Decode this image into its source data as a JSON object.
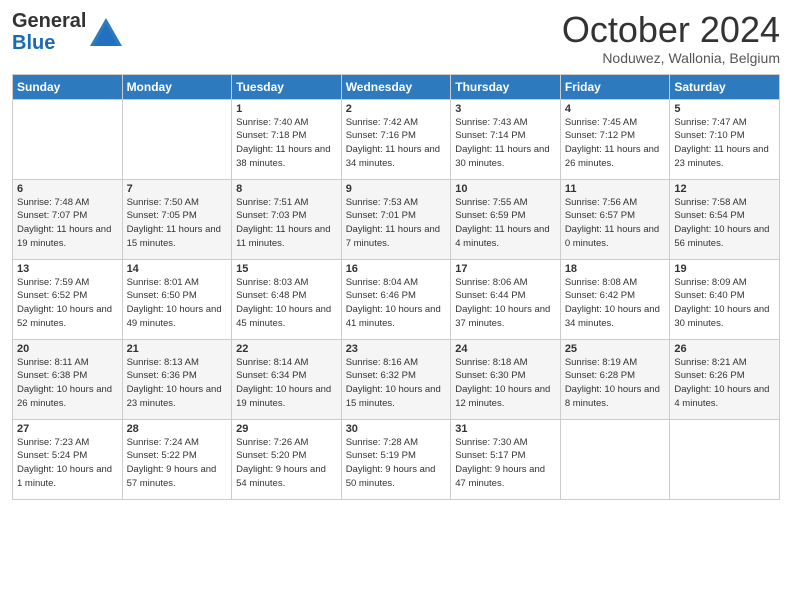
{
  "header": {
    "logo_line1": "General",
    "logo_line2": "Blue",
    "month": "October 2024",
    "location": "Noduwez, Wallonia, Belgium"
  },
  "days_of_week": [
    "Sunday",
    "Monday",
    "Tuesday",
    "Wednesday",
    "Thursday",
    "Friday",
    "Saturday"
  ],
  "weeks": [
    [
      {
        "day": "",
        "info": ""
      },
      {
        "day": "",
        "info": ""
      },
      {
        "day": "1",
        "info": "Sunrise: 7:40 AM\nSunset: 7:18 PM\nDaylight: 11 hours and 38 minutes."
      },
      {
        "day": "2",
        "info": "Sunrise: 7:42 AM\nSunset: 7:16 PM\nDaylight: 11 hours and 34 minutes."
      },
      {
        "day": "3",
        "info": "Sunrise: 7:43 AM\nSunset: 7:14 PM\nDaylight: 11 hours and 30 minutes."
      },
      {
        "day": "4",
        "info": "Sunrise: 7:45 AM\nSunset: 7:12 PM\nDaylight: 11 hours and 26 minutes."
      },
      {
        "day": "5",
        "info": "Sunrise: 7:47 AM\nSunset: 7:10 PM\nDaylight: 11 hours and 23 minutes."
      }
    ],
    [
      {
        "day": "6",
        "info": "Sunrise: 7:48 AM\nSunset: 7:07 PM\nDaylight: 11 hours and 19 minutes."
      },
      {
        "day": "7",
        "info": "Sunrise: 7:50 AM\nSunset: 7:05 PM\nDaylight: 11 hours and 15 minutes."
      },
      {
        "day": "8",
        "info": "Sunrise: 7:51 AM\nSunset: 7:03 PM\nDaylight: 11 hours and 11 minutes."
      },
      {
        "day": "9",
        "info": "Sunrise: 7:53 AM\nSunset: 7:01 PM\nDaylight: 11 hours and 7 minutes."
      },
      {
        "day": "10",
        "info": "Sunrise: 7:55 AM\nSunset: 6:59 PM\nDaylight: 11 hours and 4 minutes."
      },
      {
        "day": "11",
        "info": "Sunrise: 7:56 AM\nSunset: 6:57 PM\nDaylight: 11 hours and 0 minutes."
      },
      {
        "day": "12",
        "info": "Sunrise: 7:58 AM\nSunset: 6:54 PM\nDaylight: 10 hours and 56 minutes."
      }
    ],
    [
      {
        "day": "13",
        "info": "Sunrise: 7:59 AM\nSunset: 6:52 PM\nDaylight: 10 hours and 52 minutes."
      },
      {
        "day": "14",
        "info": "Sunrise: 8:01 AM\nSunset: 6:50 PM\nDaylight: 10 hours and 49 minutes."
      },
      {
        "day": "15",
        "info": "Sunrise: 8:03 AM\nSunset: 6:48 PM\nDaylight: 10 hours and 45 minutes."
      },
      {
        "day": "16",
        "info": "Sunrise: 8:04 AM\nSunset: 6:46 PM\nDaylight: 10 hours and 41 minutes."
      },
      {
        "day": "17",
        "info": "Sunrise: 8:06 AM\nSunset: 6:44 PM\nDaylight: 10 hours and 37 minutes."
      },
      {
        "day": "18",
        "info": "Sunrise: 8:08 AM\nSunset: 6:42 PM\nDaylight: 10 hours and 34 minutes."
      },
      {
        "day": "19",
        "info": "Sunrise: 8:09 AM\nSunset: 6:40 PM\nDaylight: 10 hours and 30 minutes."
      }
    ],
    [
      {
        "day": "20",
        "info": "Sunrise: 8:11 AM\nSunset: 6:38 PM\nDaylight: 10 hours and 26 minutes."
      },
      {
        "day": "21",
        "info": "Sunrise: 8:13 AM\nSunset: 6:36 PM\nDaylight: 10 hours and 23 minutes."
      },
      {
        "day": "22",
        "info": "Sunrise: 8:14 AM\nSunset: 6:34 PM\nDaylight: 10 hours and 19 minutes."
      },
      {
        "day": "23",
        "info": "Sunrise: 8:16 AM\nSunset: 6:32 PM\nDaylight: 10 hours and 15 minutes."
      },
      {
        "day": "24",
        "info": "Sunrise: 8:18 AM\nSunset: 6:30 PM\nDaylight: 10 hours and 12 minutes."
      },
      {
        "day": "25",
        "info": "Sunrise: 8:19 AM\nSunset: 6:28 PM\nDaylight: 10 hours and 8 minutes."
      },
      {
        "day": "26",
        "info": "Sunrise: 8:21 AM\nSunset: 6:26 PM\nDaylight: 10 hours and 4 minutes."
      }
    ],
    [
      {
        "day": "27",
        "info": "Sunrise: 7:23 AM\nSunset: 5:24 PM\nDaylight: 10 hours and 1 minute."
      },
      {
        "day": "28",
        "info": "Sunrise: 7:24 AM\nSunset: 5:22 PM\nDaylight: 9 hours and 57 minutes."
      },
      {
        "day": "29",
        "info": "Sunrise: 7:26 AM\nSunset: 5:20 PM\nDaylight: 9 hours and 54 minutes."
      },
      {
        "day": "30",
        "info": "Sunrise: 7:28 AM\nSunset: 5:19 PM\nDaylight: 9 hours and 50 minutes."
      },
      {
        "day": "31",
        "info": "Sunrise: 7:30 AM\nSunset: 5:17 PM\nDaylight: 9 hours and 47 minutes."
      },
      {
        "day": "",
        "info": ""
      },
      {
        "day": "",
        "info": ""
      }
    ]
  ]
}
